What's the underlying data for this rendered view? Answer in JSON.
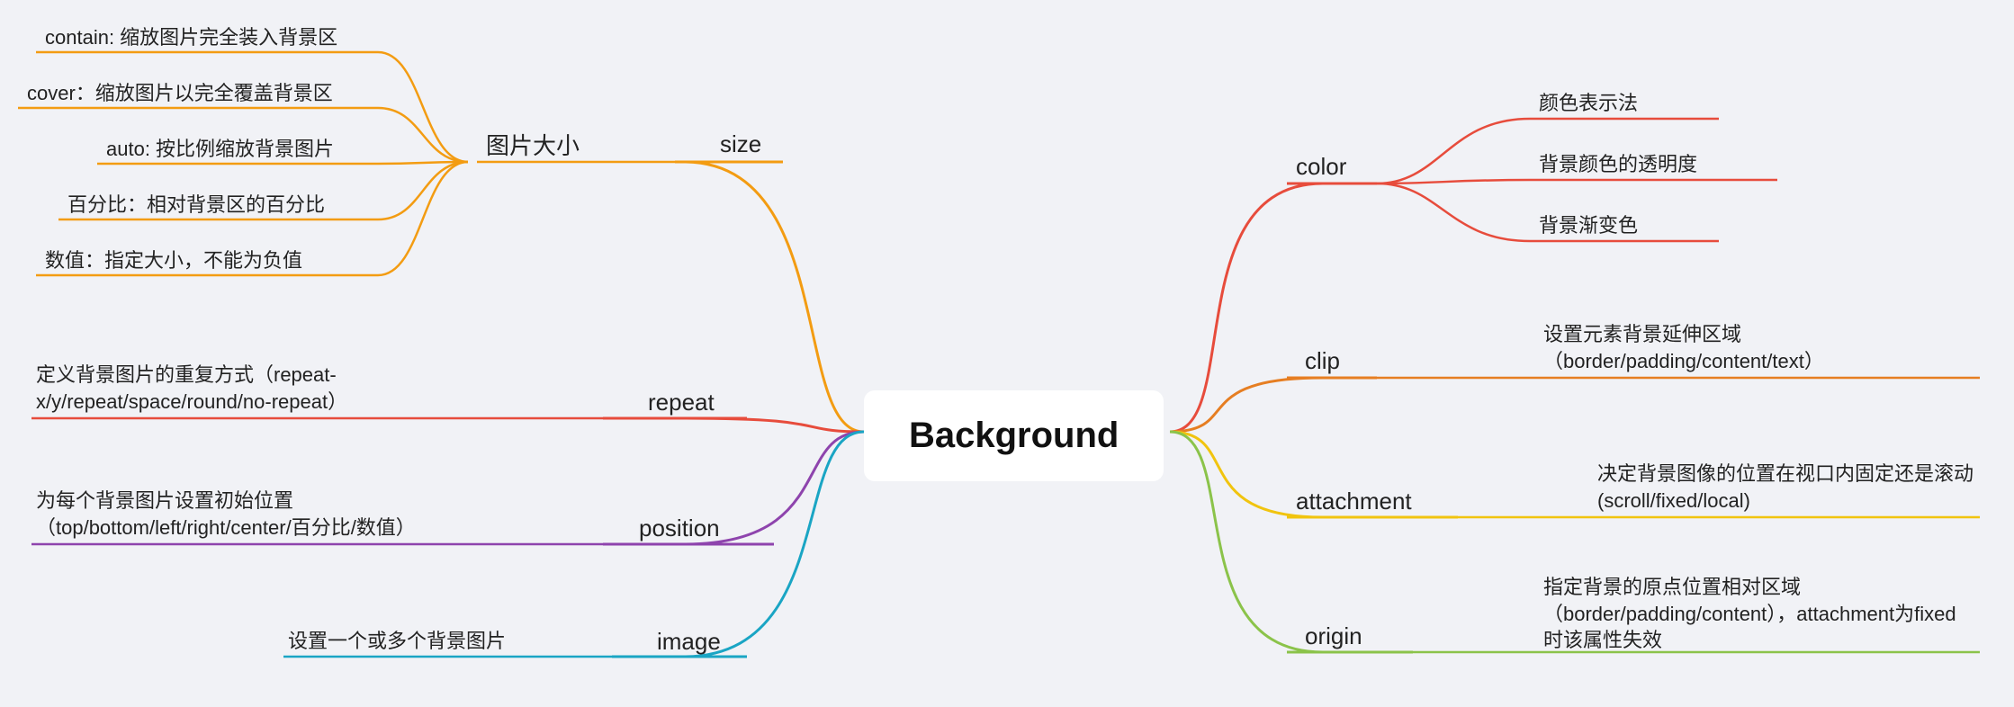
{
  "center": {
    "label": "Background"
  },
  "right": {
    "color": {
      "label": "color",
      "children": [
        {
          "label": "颜色表示法"
        },
        {
          "label": "背景颜色的透明度"
        },
        {
          "label": "背景渐变色"
        }
      ]
    },
    "clip": {
      "label": "clip",
      "detail": "设置元素背景延伸区域（border/padding/content/text）"
    },
    "attachment": {
      "label": "attachment",
      "detail": "决定背景图像的位置在视口内固定还是滚动(scroll/fixed/local)"
    },
    "origin": {
      "label": "origin",
      "detail": "指定背景的原点位置相对区域（border/padding/content），attachment为fixed时该属性失效"
    }
  },
  "left": {
    "size": {
      "label": "size",
      "sub": "图片大小",
      "children": [
        {
          "label": "contain: 缩放图片完全装入背景区"
        },
        {
          "label": "cover：缩放图片以完全覆盖背景区"
        },
        {
          "label": "auto: 按比例缩放背景图片"
        },
        {
          "label": "百分比：相对背景区的百分比"
        },
        {
          "label": "数值：指定大小，不能为负值"
        }
      ]
    },
    "repeat": {
      "label": "repeat",
      "detail": "定义背景图片的重复方式（repeat-x/y/repeat/space/round/no-repeat）"
    },
    "position": {
      "label": "position",
      "detail": "为每个背景图片设置初始位置（top/bottom/left/right/center/百分比/数值）"
    },
    "image": {
      "label": "image",
      "detail": "设置一个或多个背景图片"
    }
  },
  "colors": {
    "red": "#e74c3c",
    "orange": "#f39c12",
    "yellow": "#f1c40f",
    "green": "#8bc34a",
    "darkorange": "#e67e22",
    "purple": "#8e44ad",
    "cyan": "#1aa5c4",
    "magenta": "#e91e63"
  }
}
